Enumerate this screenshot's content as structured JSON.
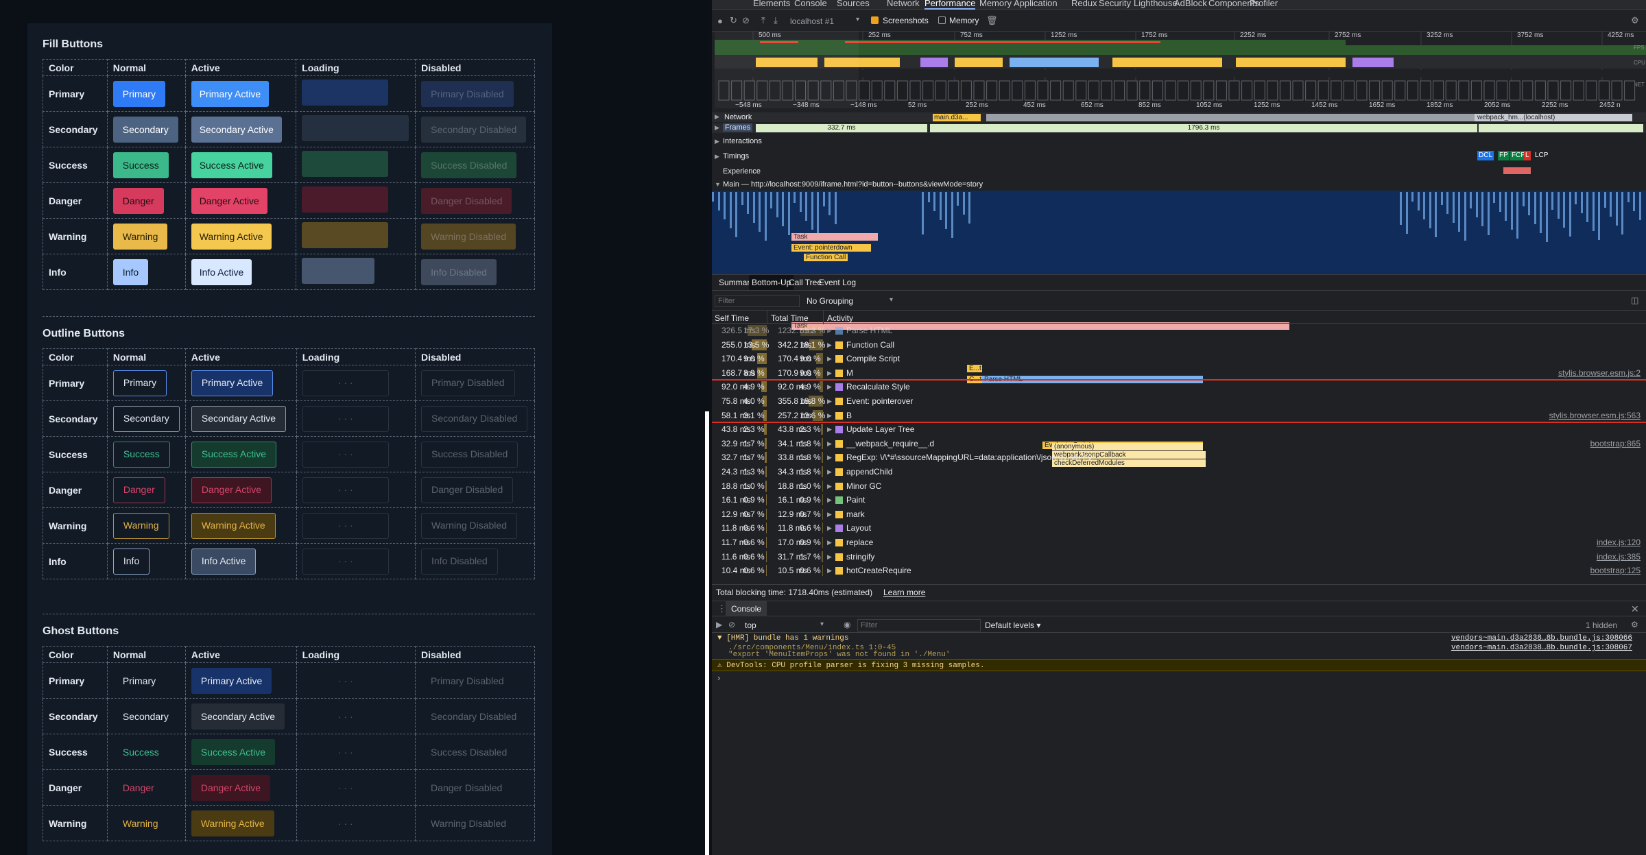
{
  "storybook": {
    "sections": [
      {
        "title": "Fill Buttons",
        "variant": "fill",
        "headers": [
          "Color",
          "Normal",
          "Active",
          "Loading",
          "Disabled"
        ],
        "rows": [
          {
            "name": "Primary",
            "normal": "Primary",
            "active": "Primary Active",
            "disabled": "Primary Disabled"
          },
          {
            "name": "Secondary",
            "normal": "Secondary",
            "active": "Secondary Active",
            "disabled": "Secondary Disabled"
          },
          {
            "name": "Success",
            "normal": "Success",
            "active": "Success Active",
            "disabled": "Success Disabled"
          },
          {
            "name": "Danger",
            "normal": "Danger",
            "active": "Danger Active",
            "disabled": "Danger Disabled"
          },
          {
            "name": "Warning",
            "normal": "Warning",
            "active": "Warning Active",
            "disabled": "Warning Disabled"
          },
          {
            "name": "Info",
            "normal": "Info",
            "active": "Info Active",
            "disabled": "Info Disabled"
          }
        ]
      },
      {
        "title": "Outline Buttons",
        "variant": "outline",
        "headers": [
          "Color",
          "Normal",
          "Active",
          "Loading",
          "Disabled"
        ],
        "rows": [
          {
            "name": "Primary",
            "normal": "Primary",
            "active": "Primary Active",
            "disabled": "Primary Disabled"
          },
          {
            "name": "Secondary",
            "normal": "Secondary",
            "active": "Secondary Active",
            "disabled": "Secondary Disabled"
          },
          {
            "name": "Success",
            "normal": "Success",
            "active": "Success Active",
            "disabled": "Success Disabled"
          },
          {
            "name": "Danger",
            "normal": "Danger",
            "active": "Danger Active",
            "disabled": "Danger Disabled"
          },
          {
            "name": "Warning",
            "normal": "Warning",
            "active": "Warning Active",
            "disabled": "Warning Disabled"
          },
          {
            "name": "Info",
            "normal": "Info",
            "active": "Info Active",
            "disabled": "Info Disabled"
          }
        ]
      },
      {
        "title": "Ghost Buttons",
        "variant": "ghost",
        "headers": [
          "Color",
          "Normal",
          "Active",
          "Loading",
          "Disabled"
        ],
        "rows": [
          {
            "name": "Primary",
            "normal": "Primary",
            "active": "Primary Active",
            "disabled": "Primary Disabled"
          },
          {
            "name": "Secondary",
            "normal": "Secondary",
            "active": "Secondary Active",
            "disabled": "Secondary Disabled"
          },
          {
            "name": "Success",
            "normal": "Success",
            "active": "Success Active",
            "disabled": "Success Disabled"
          },
          {
            "name": "Danger",
            "normal": "Danger",
            "active": "Danger Active",
            "disabled": "Danger Disabled"
          },
          {
            "name": "Warning",
            "normal": "Warning",
            "active": "Warning Active",
            "disabled": "Warning Disabled"
          }
        ]
      }
    ],
    "colors": {
      "Primary": {
        "fill": "#2f7bf5",
        "active": "#3e8ef7",
        "loading": "#1c3463",
        "disabled": "#1e2f52",
        "outline": "#5a8ff0",
        "ghost_active_bg": "#17336a",
        "text": "#ffffff",
        "ghost_text": "#e6ebf2"
      },
      "Secondary": {
        "fill": "#4d6382",
        "active": "#5a7194",
        "loading": "#24303f",
        "disabled": "#26303d",
        "outline": "#8b96a6",
        "ghost_active_bg": "#262c35",
        "text": "#ffffff",
        "ghost_text": "#e6ebf2"
      },
      "Success": {
        "fill": "#3bb98a",
        "active": "#47d39e",
        "loading": "#1d4a3b",
        "disabled": "#1c4737",
        "outline": "#2f8f6c",
        "ghost_active_bg": "#153b2e",
        "text": "#0b1f18",
        "ghost_text": "#3ec08f"
      },
      "Danger": {
        "fill": "#d63a5c",
        "active": "#e34366",
        "loading": "#4b1b2b",
        "disabled": "#4a1c2a",
        "outline": "#a23350",
        "ghost_active_bg": "#3d1622",
        "text": "#2a0c13",
        "ghost_text": "#d8456a"
      },
      "Warning": {
        "fill": "#e9b949",
        "active": "#f4c84f",
        "loading": "#5a4a23",
        "disabled": "#544523",
        "outline": "#b8902f",
        "ghost_active_bg": "#4a3b13",
        "text": "#2a2005",
        "ghost_text": "#e2b445"
      },
      "Info": {
        "fill": "#a7c8ff",
        "active": "#d8e9ff",
        "loading": "#46566e",
        "disabled": "#3e4a5c",
        "outline": "#8fa7c8",
        "ghost_active_bg": "#3a4a62",
        "text": "#0a1a33",
        "ghost_text": "#e6ebf2"
      }
    }
  },
  "devtools": {
    "tabs": [
      "Elements",
      "Console",
      "Sources",
      "Network",
      "Performance",
      "Memory",
      "Application",
      "Redux",
      "Security",
      "Lighthouse",
      "AdBlock",
      "Components",
      "Profiler"
    ],
    "active_tab": "Performance",
    "toolbar": {
      "target": "localhost #1",
      "screenshots_label": "Screenshots",
      "memory_label": "Memory"
    },
    "overview_ticks": [
      "500 ms",
      "252 ms",
      "752 ms",
      "1252 ms",
      "1752 ms",
      "2252 ms",
      "2752 ms",
      "3252 ms",
      "3752 ms",
      "4252 ms"
    ],
    "overview_lanes": [
      "FPS",
      "CPU",
      "NET"
    ],
    "ruler_ticks": [
      "−548 ms",
      "−348 ms",
      "−148 ms",
      "52 ms",
      "252 ms",
      "452 ms",
      "652 ms",
      "852 ms",
      "1052 ms",
      "1252 ms",
      "1452 ms",
      "1652 ms",
      "1852 ms",
      "2052 ms",
      "2252 ms",
      "2452 n"
    ],
    "tracks": {
      "network": "Network",
      "network_items": [
        "main.d3a...",
        "webpack_hm...(localhost)"
      ],
      "frames": "Frames",
      "frame_times": [
        "332.7 ms",
        "1796.3 ms"
      ],
      "interactions": "Interactions",
      "timings": "Timings",
      "timing_markers": [
        "DCL",
        "FP",
        "FCP",
        "L",
        "LCP"
      ],
      "experience": "Experience",
      "main": "Main — http://localhost:9009/iframe.html?id=button--buttons&viewMode=story"
    },
    "flame": [
      {
        "label": "Task",
        "color": "#f1aaaa"
      },
      {
        "label": "Event: pointerdown",
        "color": "#f6c545"
      },
      {
        "label": "Function Call",
        "color": "#f6c545"
      },
      {
        "label": "Task",
        "color": "#f1aaaa"
      },
      {
        "label": "E...t",
        "color": "#f6c545"
      },
      {
        "label": "Parse HTML",
        "color": "#7ab2f0"
      },
      {
        "label": "C...t",
        "color": "#f6c545"
      },
      {
        "label": "Evaluate Script",
        "color": "#f6c545"
      },
      {
        "label": "(anonymous)",
        "color": "#fbe6a8"
      },
      {
        "label": "webpackJsonpCallback",
        "color": "#fbe6a8"
      },
      {
        "label": "checkDeferredModules",
        "color": "#fbe6a8"
      }
    ],
    "panel_tabs": [
      "Summary",
      "Bottom-Up",
      "Call Tree",
      "Event Log"
    ],
    "active_panel_tab": "Bottom-Up",
    "filter_placeholder": "Filter",
    "grouping": "No Grouping",
    "columns": [
      "Self Time",
      "Total Time",
      "Activity"
    ],
    "rows": [
      {
        "self": "326.5 ms",
        "self_pct": "17.3 %",
        "total": "1232.7 ms",
        "total_pct": "65.2 %",
        "activity": "Parse HTML",
        "color": "#7ab2f0",
        "link": "",
        "dim": true
      },
      {
        "self": "255.0 ms",
        "self_pct": "13.5 %",
        "total": "342.2 ms",
        "total_pct": "18.1 %",
        "activity": "Function Call",
        "color": "#f6c545",
        "link": ""
      },
      {
        "self": "170.4 ms",
        "self_pct": "9.0 %",
        "total": "170.4 ms",
        "total_pct": "9.0 %",
        "activity": "Compile Script",
        "color": "#f6c545",
        "link": ""
      },
      {
        "self": "168.7 ms",
        "self_pct": "8.9 %",
        "total": "170.9 ms",
        "total_pct": "9.0 %",
        "activity": "M",
        "color": "#f6c545",
        "link": "stylis.browser.esm.js:2"
      },
      {
        "self": "92.0 ms",
        "self_pct": "4.9 %",
        "total": "92.0 ms",
        "total_pct": "4.9 %",
        "activity": "Recalculate Style",
        "color": "#a97ee8",
        "link": ""
      },
      {
        "self": "75.8 ms",
        "self_pct": "4.0 %",
        "total": "355.8 ms",
        "total_pct": "18.8 %",
        "activity": "Event: pointerover",
        "color": "#f6c545",
        "link": ""
      },
      {
        "self": "58.1 ms",
        "self_pct": "3.1 %",
        "total": "257.2 ms",
        "total_pct": "13.6 %",
        "activity": "B",
        "color": "#f6c545",
        "link": "stylis.browser.esm.js:563"
      },
      {
        "self": "43.8 ms",
        "self_pct": "2.3 %",
        "total": "43.8 ms",
        "total_pct": "2.3 %",
        "activity": "Update Layer Tree",
        "color": "#a97ee8",
        "link": ""
      },
      {
        "self": "32.9 ms",
        "self_pct": "1.7 %",
        "total": "34.1 ms",
        "total_pct": "1.8 %",
        "activity": "__webpack_require__.d",
        "color": "#f6c545",
        "link": "bootstrap:865"
      },
      {
        "self": "32.7 ms",
        "self_pct": "1.7 %",
        "total": "33.8 ms",
        "total_pct": "1.8 %",
        "activity": "RegExp: \\/\\*#\\ssourceMappingURL=data:application\\/json;\\S+\\s+\\*\\/",
        "color": "#f6c545",
        "link": ""
      },
      {
        "self": "24.3 ms",
        "self_pct": "1.3 %",
        "total": "34.3 ms",
        "total_pct": "1.8 %",
        "activity": "appendChild",
        "color": "#f6c545",
        "link": ""
      },
      {
        "self": "18.8 ms",
        "self_pct": "1.0 %",
        "total": "18.8 ms",
        "total_pct": "1.0 %",
        "activity": "Minor GC",
        "color": "#f6c545",
        "link": ""
      },
      {
        "self": "16.1 ms",
        "self_pct": "0.9 %",
        "total": "16.1 ms",
        "total_pct": "0.9 %",
        "activity": "Paint",
        "color": "#74c27b",
        "link": ""
      },
      {
        "self": "12.9 ms",
        "self_pct": "0.7 %",
        "total": "12.9 ms",
        "total_pct": "0.7 %",
        "activity": "mark",
        "color": "#f6c545",
        "link": ""
      },
      {
        "self": "11.8 ms",
        "self_pct": "0.6 %",
        "total": "11.8 ms",
        "total_pct": "0.6 %",
        "activity": "Layout",
        "color": "#a97ee8",
        "link": ""
      },
      {
        "self": "11.7 ms",
        "self_pct": "0.6 %",
        "total": "17.0 ms",
        "total_pct": "0.9 %",
        "activity": "replace",
        "color": "#f6c545",
        "link": "index.js:120"
      },
      {
        "self": "11.6 ms",
        "self_pct": "0.6 %",
        "total": "31.7 ms",
        "total_pct": "1.7 %",
        "activity": "stringify",
        "color": "#f6c545",
        "link": "index.js:385"
      },
      {
        "self": "10.4 ms",
        "self_pct": "0.6 %",
        "total": "10.5 ms",
        "total_pct": "0.6 %",
        "activity": "hotCreateRequire",
        "color": "#f6c545",
        "link": "bootstrap:125"
      }
    ],
    "blocking_text": "Total blocking time: 1718.40ms (estimated)",
    "learn_more": "Learn more",
    "console": {
      "tab": "Console",
      "context": "top",
      "filter_placeholder": "Filter",
      "levels": "Default levels ▾",
      "hidden": "1 hidden",
      "messages": [
        {
          "text": "▼ [HMR] bundle has 1 warnings",
          "source": "vendors~main.d3a2838…8b.bundle.js:308066",
          "kind": "warn"
        },
        {
          "text": "./src/components/Menu/index.ts 1:0-45",
          "source": "vendors~main.d3a2838…8b.bundle.js:308067",
          "kind": "warn-sub"
        },
        {
          "text": "\"export 'MenuItemProps' was not found in './Menu'",
          "source": "",
          "kind": "warn-sub"
        },
        {
          "text": "⚠ DevTools: CPU profile parser is fixing 3 missing samples.",
          "source": "",
          "kind": "warn-bar"
        }
      ],
      "prompt": "›"
    }
  }
}
